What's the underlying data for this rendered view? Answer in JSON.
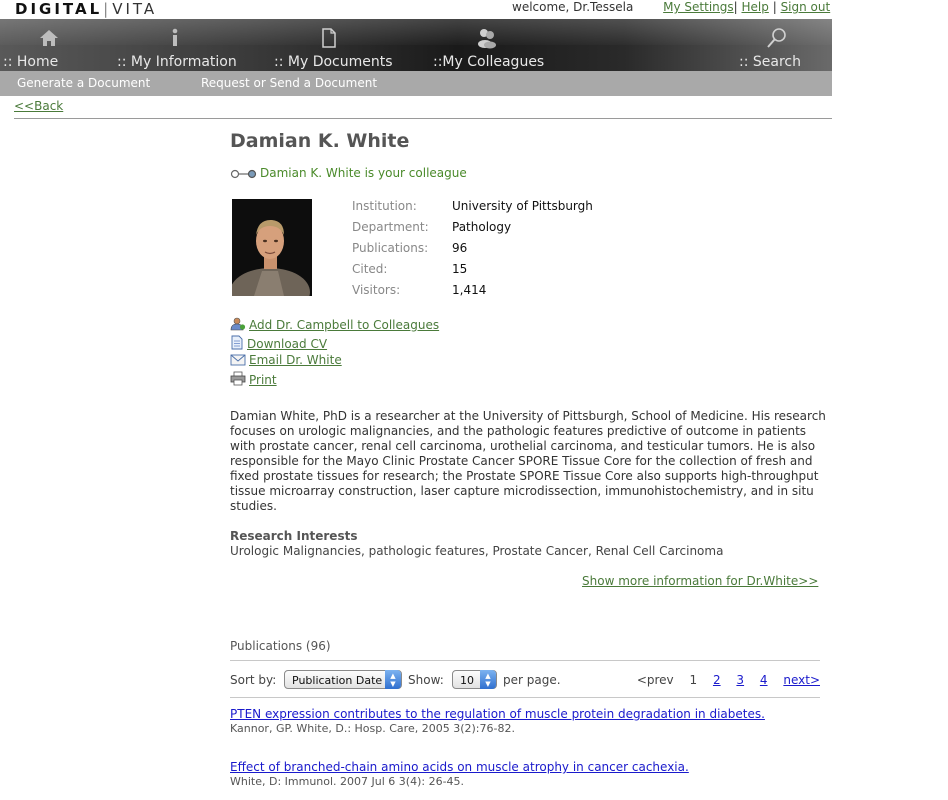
{
  "brand": {
    "part1": "DIGITAL",
    "part2": "VITA"
  },
  "top": {
    "welcome": "welcome, Dr.Tessela",
    "settings": "My Settings",
    "help": "Help",
    "signout": "Sign out"
  },
  "nav": {
    "home": ":: Home",
    "info": ":: My Information",
    "docs": ":: My Documents",
    "colleagues": "::My Colleagues",
    "search": ":: Search"
  },
  "subnav": {
    "generate": "Generate a Document",
    "request": "Request or Send a Document"
  },
  "back": "<<Back",
  "profile": {
    "name": "Damian K. White",
    "relation": "Damian K. White is your colleague",
    "fields": [
      {
        "label": "Institution:",
        "value": "University of Pittsburgh"
      },
      {
        "label": "Department:",
        "value": "Pathology"
      },
      {
        "label": "Publications:",
        "value": "96"
      },
      {
        "label": "Cited:",
        "value": "15"
      },
      {
        "label": "Visitors:",
        "value": "1,414"
      }
    ]
  },
  "actions": {
    "add": "Add Dr. Campbell to Colleagues",
    "cv": "Download CV",
    "email": "Email Dr. White",
    "print": "Print"
  },
  "bio": "Damian White, PhD is a researcher at the University of Pittsburgh, School of Medicine. His research focuses on urologic malignancies, and the pathologic features predictive of outcome in patients with prostate cancer, renal cell carcinoma, urothelial carcinoma, and testicular tumors. He is also responsible for the Mayo Clinic Prostate Cancer SPORE Tissue Core for the collection of fresh and fixed prostate tissues for research; the Prostate SPORE Tissue Core also supports high-throughput tissue microarray construction, laser capture microdissection, immunohistochemistry, and in situ studies.",
  "research": {
    "heading": "Research Interests",
    "value": "Urologic Malignancies, pathologic features, Prostate Cancer, Renal Cell Carcinoma"
  },
  "more_link": "Show more information for Dr.White>>",
  "publications": {
    "heading": "Publications (96)",
    "sort_label": "Sort by:",
    "sort_value": "Publication Date",
    "show_label": "Show:",
    "show_value": "10",
    "per_page": "per page.",
    "pager": {
      "prev": "<prev",
      "current": "1",
      "p2": "2",
      "p3": "3",
      "p4": "4",
      "next": "next>"
    },
    "items": [
      {
        "title": "PTEN expression contributes to the regulation of muscle protein degradation in diabetes.",
        "cite": "Kannor, GP. White, D.: Hosp. Care, 2005 3(2):76-82."
      },
      {
        "title": "Effect of branched-chain amino acids on muscle atrophy in cancer cachexia.",
        "cite": "White, D: Immunol. 2007 Jul 6 3(4): 26-45."
      }
    ]
  }
}
